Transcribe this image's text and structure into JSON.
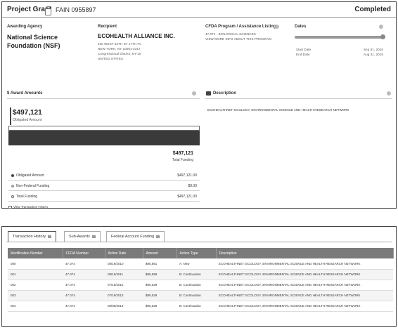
{
  "header": {
    "title": "Project Grant",
    "fain": "FAIN  0955897",
    "status": "Completed"
  },
  "agency": {
    "label": "Awarding Agency",
    "name": "National Science Foundation (NSF)"
  },
  "recipient": {
    "label": "Recipient",
    "name": "ECOHEALTH ALLIANCE INC.",
    "address": [
      "460 WEST 34TH ST 17TH FL",
      "NEW YORK, NY 10001-2317",
      "Congressional District: NY-10",
      "UNITED STATES"
    ]
  },
  "cfda": {
    "label": "CFDA Program / Assistance Listing",
    "line1": "47.074 - BIOLOGICAL SCIENCES",
    "line2": "VIEW MORE INFO ABOUT THIS PROGRAM"
  },
  "dates": {
    "label": "Dates",
    "start_label": "Start Date",
    "start_value": "Sep 01, 2010",
    "end_label": "End Date",
    "end_value": "Aug 31, 2015"
  },
  "award_amounts": {
    "label": "$ Award Amounts",
    "obligated_value": "$497,121",
    "obligated_label": "Obligated Amount",
    "total_value": "$497,121",
    "total_label": "Total Funding",
    "rows": [
      {
        "label": "Obligated Amount",
        "value": "$497,121.00",
        "color": "#444444"
      },
      {
        "label": "Non-Federal Funding",
        "value": "$0.00",
        "color": "#9e9e9e"
      },
      {
        "label": "Total Funding",
        "value": "$497,121.00",
        "color": "#ffffff"
      }
    ],
    "history_link": "View Transaction History"
  },
  "description": {
    "label": "Description",
    "text": "ECOHEALTHNET: ECOLOGY, ENVIRONMENTAL SCIENCE AND HEALTH RESEARCH NETWORK"
  },
  "tabs": [
    {
      "label": "Transaction History"
    },
    {
      "label": "Sub-Awards"
    },
    {
      "label": "Federal Account Funding"
    }
  ],
  "table": {
    "columns": [
      "Modification Number",
      "CFDA Number",
      "Action Date",
      "Amount",
      "Action Type",
      "Description"
    ],
    "rows": [
      [
        "000",
        "47.074",
        "08/19/2010",
        "$95,681",
        "A: New",
        "ECOHEALTHNET: ECOLOGY, ENVIRONMENTAL SCIENCE AND HEALTH RESEARCH NETWORK"
      ],
      [
        "001",
        "47.074",
        "08/16/2011",
        "$95,599",
        "B: Continuation",
        "ECOHEALTHNET: ECOLOGY, ENVIRONMENTAL SCIENCE AND HEALTH RESEARCH NETWORK"
      ],
      [
        "002",
        "47.074",
        "07/16/2012",
        "$99,529",
        "B: Continuation",
        "ECOHEALTHNET: ECOLOGY, ENVIRONMENTAL SCIENCE AND HEALTH RESEARCH NETWORK"
      ],
      [
        "003",
        "47.074",
        "07/18/2013",
        "$99,529",
        "B: Continuation",
        "ECOHEALTHNET: ECOLOGY, ENVIRONMENTAL SCIENCE AND HEALTH RESEARCH NETWORK"
      ],
      [
        "004",
        "47.074",
        "08/05/2014",
        "$96,528",
        "B: Continuation",
        "ECOHEALTHNET: ECOLOGY, ENVIRONMENTAL SCIENCE AND HEALTH RESEARCH NETWORK"
      ]
    ]
  }
}
